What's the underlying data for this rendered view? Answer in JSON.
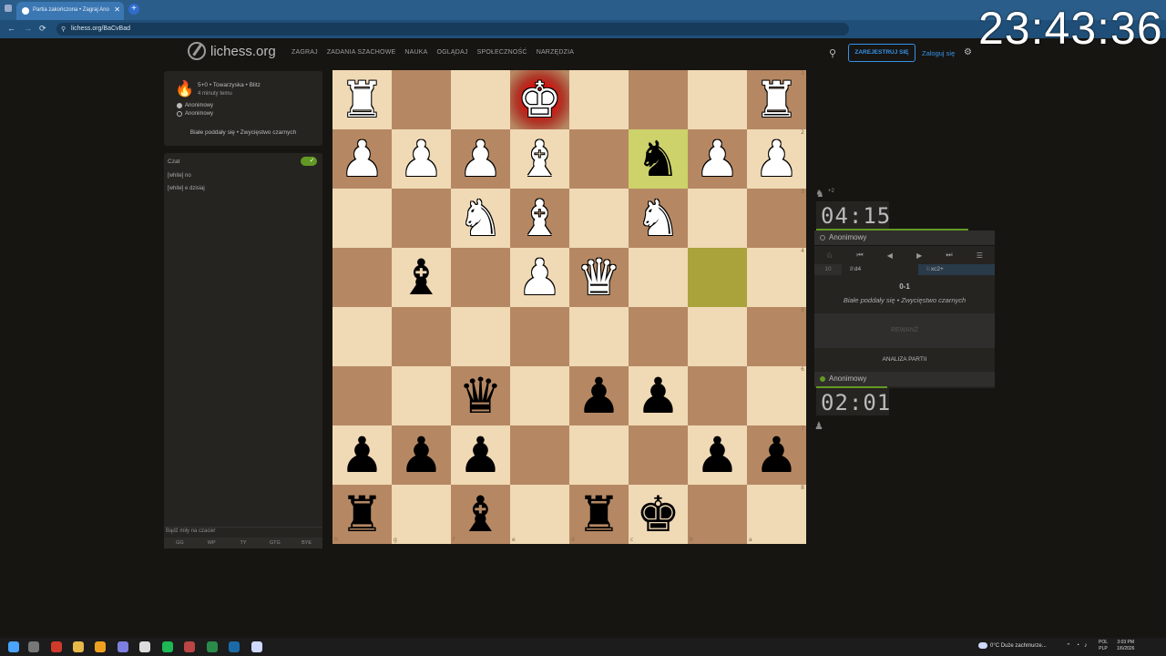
{
  "browser": {
    "tab_title": "Partia zakończona • Zagraj Ano",
    "tab_close": "✕",
    "new_tab": "+",
    "url": "lichess.org/BaCvBad",
    "clock_overlay": "23:43:36",
    "nav": {
      "back": "←",
      "forward": "→",
      "reload": "⟳"
    }
  },
  "site": {
    "logo_text": "lichess.org",
    "nav_links": [
      "ZAGRAJ",
      "ZADANIA SZACHOWE",
      "NAUKA",
      "OGLĄDAJ",
      "SPOŁECZNOŚĆ",
      "NARZĘDZIA"
    ],
    "register_label": "ZAREJESTRUJ SIĘ",
    "login_label": "Zaloguj się",
    "search_icon": "search-icon",
    "gear_icon": "gear-icon"
  },
  "game_info": {
    "type": "5+0 • Towarzyska • Blitz",
    "time_ago": "4 minuty temu",
    "player_white": "Anonimowy",
    "player_black": "Anonimowy",
    "result": "Białe poddały się • Zwycięstwo czarnych"
  },
  "chat": {
    "title": "Czat",
    "messages": [
      "[white] no",
      "[white] e dzisiaj"
    ],
    "placeholder": "Bądź miły na czacie!",
    "presets": [
      "GG",
      "WP",
      "TY",
      "GTG",
      "BYE"
    ]
  },
  "board": {
    "orientation": "black",
    "rows": [
      [
        "wR",
        "",
        "",
        "wK",
        "",
        "",
        "",
        "wR"
      ],
      [
        "wP",
        "wP",
        "wP",
        "wB",
        "",
        "bN",
        "wP",
        "wP"
      ],
      [
        "",
        "",
        "wN",
        "wB",
        "",
        "wN",
        "",
        ""
      ],
      [
        "",
        "bB",
        "",
        "wP",
        "wQ",
        "",
        "",
        ""
      ],
      [
        "",
        "",
        "",
        "",
        "",
        "",
        "",
        ""
      ],
      [
        "",
        "",
        "bQ",
        "",
        "bP",
        "bP",
        "",
        ""
      ],
      [
        "bP",
        "bP",
        "bP",
        "",
        "",
        "",
        "bP",
        "bP"
      ],
      [
        "bR",
        "",
        "bB",
        "",
        "bR",
        "bK",
        "",
        ""
      ]
    ],
    "check_square": [
      0,
      3
    ],
    "last_move_squares": [
      [
        1,
        5
      ],
      [
        3,
        6
      ]
    ],
    "rank_labels": [
      "1",
      "2",
      "3",
      "4",
      "5",
      "6",
      "7",
      "8"
    ],
    "file_labels": [
      "h",
      "g",
      "f",
      "e",
      "d",
      "c",
      "b",
      "a"
    ]
  },
  "right_panel": {
    "opponent_material": "+2",
    "top_clock": "04:15",
    "top_player": "Anonimowy",
    "controls": [
      "♘",
      "⏮",
      "◀",
      "▶",
      "⏭",
      "☰"
    ],
    "move": {
      "number": "10",
      "white": "♕d4",
      "black": "♘xc2+"
    },
    "score": "0-1",
    "result_text": "Białe poddały się • Zwycięstwo czarnych",
    "rematch_label": "REWANŻ",
    "analysis_label": "ANALIZA PARTII",
    "bottom_player": "Anonimowy",
    "bottom_clock": "02:01"
  },
  "taskbar": {
    "weather": "0°C  Duże zachmurze...",
    "language": "POL\nPLP",
    "time": "3:03 PM",
    "date": "1/6/2026"
  }
}
